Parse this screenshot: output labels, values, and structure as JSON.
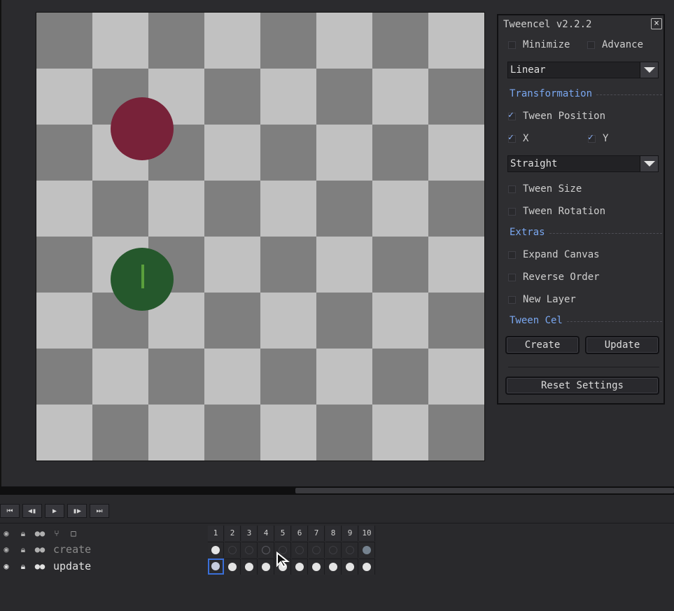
{
  "panel": {
    "title": "Tweencel v2.2.2",
    "close": "×",
    "minimize_label": "Minimize",
    "advance_label": "Advance",
    "easing_value": "Linear",
    "transformation_label": "Transformation",
    "tween_position_label": "Tween Position",
    "x_label": "X",
    "y_label": "Y",
    "path_value": "Straight",
    "tween_size_label": "Tween Size",
    "tween_rotation_label": "Tween Rotation",
    "extras_label": "Extras",
    "expand_canvas_label": "Expand Canvas",
    "reverse_order_label": "Reverse Order",
    "new_layer_label": "New Layer",
    "tween_cel_label": "Tween Cel",
    "create_label": "Create",
    "update_label": "Update",
    "reset_label": "Reset Settings"
  },
  "timeline": {
    "playback": [
      "⏮",
      "◀▮",
      "▶",
      "▮▶",
      "⏭"
    ],
    "frames": [
      "1",
      "2",
      "3",
      "4",
      "5",
      "6",
      "7",
      "8",
      "9",
      "10"
    ],
    "layers": [
      {
        "name": "create",
        "dim": true
      },
      {
        "name": "update",
        "dim": false
      }
    ]
  },
  "colors": {
    "accent": "#7aa7f0",
    "red_ball": "#782239",
    "green_ball": "#25582c",
    "selection": "#3a6fd8"
  }
}
